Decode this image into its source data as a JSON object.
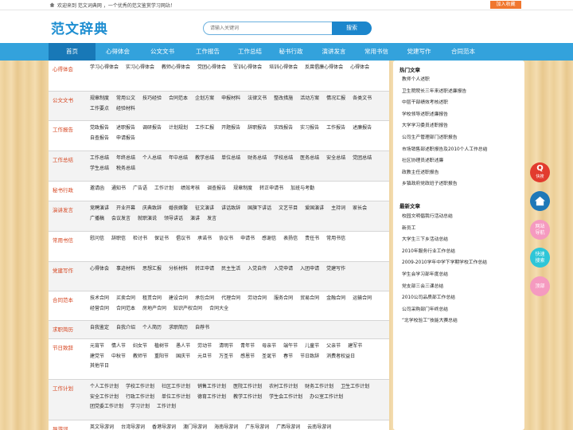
{
  "topbar": {
    "welcome": "欢迎来到 范文词典网 ，一个优秀的范文鉴赏学习网站！",
    "favorite_label": "加入收藏"
  },
  "header": {
    "logo": "范文辞典",
    "search_placeholder": "请输入关键词",
    "search_button": "搜索"
  },
  "nav": [
    "首页",
    "心得体会",
    "公文文书",
    "工作报告",
    "工作总结",
    "秘书行政",
    "演讲发言",
    "常用书信",
    "党建写作",
    "合同范本"
  ],
  "categories": [
    {
      "title": "心得体会",
      "links": [
        "学习心得体会",
        "实习心得体会",
        "教师心得体会",
        "党团心得体会",
        "军训心得体会",
        "培训心得体会",
        "反腐倡廉心得体会",
        "心得体会"
      ]
    },
    {
      "title": "公文文书",
      "links": [
        "规章制度",
        "常用公文",
        "技巧经验",
        "合同范本",
        "企划方案",
        "申报材料",
        "法律文书",
        "整改措施",
        "活动方案",
        "情况汇报",
        "各类文书",
        "工作要点",
        "经验材料"
      ]
    },
    {
      "title": "工作报告",
      "links": [
        "党政报告",
        "述职报告",
        "调研报告",
        "计划规划",
        "工作汇报",
        "开题报告",
        "辞职报告",
        "实践报告",
        "实习报告",
        "工作报告",
        "述廉报告",
        "自查报告",
        "申请报告"
      ]
    },
    {
      "title": "工作总结",
      "links": [
        "工作总结",
        "年终总结",
        "个人总结",
        "年中总结",
        "教学总结",
        "单位总结",
        "财务总结",
        "学校总结",
        "医务总结",
        "安全总结",
        "党团总结",
        "学生总结",
        "税务总结"
      ]
    },
    {
      "title": "秘书行政",
      "links": [
        "邀请函",
        "通知书",
        "广告语",
        "工作计划",
        "绩效考核",
        "调查报告",
        "规章制度",
        "转正申请书",
        "加班与考勤"
      ]
    },
    {
      "title": "演讲发言",
      "links": [
        "竞聘演讲",
        "开业开幕",
        "庆典致辞",
        "婚丧嫁娶",
        "征文演讲",
        "讲话致辞",
        "国旗下讲话",
        "文艺节目",
        "爱国演讲",
        "主持词",
        "家长会",
        "广播稿",
        "会议发言",
        "就职演说",
        "领导讲话",
        "演讲",
        "发言"
      ]
    },
    {
      "title": "常用书信",
      "links": [
        "慰问信",
        "辞职信",
        "检讨书",
        "保证书",
        "倡议书",
        "承诺书",
        "协议书",
        "申请书",
        "感谢信",
        "表扬信",
        "责任书",
        "常用书信"
      ]
    },
    {
      "title": "党建写作",
      "links": [
        "心得体会",
        "事迹材料",
        "思想汇报",
        "分析材料",
        "转正申请",
        "民主生活",
        "入党自传",
        "入党申请",
        "入团申请",
        "党建写作"
      ]
    },
    {
      "title": "合同范本",
      "links": [
        "技术合同",
        "买卖合同",
        "租赁合同",
        "建设合同",
        "承包合同",
        "代理合同",
        "劳动合同",
        "服务合同",
        "贸易合同",
        "金融合同",
        "运输合同",
        "经营合同",
        "合同范本",
        "房地产合同",
        "知识产权合同",
        "合同大全"
      ]
    },
    {
      "title": "求职简历",
      "links": [
        "自我鉴定",
        "自我介绍",
        "个人简历",
        "求职简历",
        "自荐书"
      ]
    },
    {
      "title": "节日致辞",
      "links": [
        "元宵节",
        "情人节",
        "妇女节",
        "植树节",
        "愚人节",
        "劳动节",
        "清明节",
        "青年节",
        "母亲节",
        "端午节",
        "儿童节",
        "父亲节",
        "建军节",
        "建党节",
        "中秋节",
        "教师节",
        "重阳节",
        "国庆节",
        "元旦节",
        "万圣节",
        "感恩节",
        "圣诞节",
        "春节",
        "节日致辞",
        "消费者权益日",
        "其他节日"
      ]
    },
    {
      "title": "工作计划",
      "links": [
        "个人工作计划",
        "学校工作计划",
        "社区工作计划",
        "销售工作计划",
        "医院工作计划",
        "农村工作计划",
        "财务工作计划",
        "卫生工作计划",
        "安全工作计划",
        "行政工作计划",
        "单位工作计划",
        "德育工作计划",
        "教学工作计划",
        "学生会工作计划",
        "办公室工作计划",
        "团党委工作计划",
        "学习计划",
        "工作计划"
      ]
    },
    {
      "title": "导游词",
      "links": [
        "英文导游词",
        "台湾导游词",
        "香港导游词",
        "澳门导游词",
        "海南导游词",
        "广东导游词",
        "广西导游词",
        "云南导游词"
      ]
    }
  ],
  "sidebar": {
    "hot_title": "热门文章",
    "hot": [
      "教师个人述职",
      "卫生院院长三年来述职述廉报告",
      "中层干部绩效考核述职",
      "学校领导述职述廉报告",
      "大学学习委员述职报告",
      "公司生产管理部门述职报告",
      "市场销售部述职报告及2010个人工作总结",
      "社区协理员述职述廉",
      "政教主任述职报告",
      "乡镇政府党政班子述职报告"
    ],
    "new_title": "最新文章",
    "new": [
      "校园文明倡我行活动总结",
      "新员工",
      "大学生三下乡活动总结",
      "2010年服务行业工作总结",
      "2009-2010学年中学下学期学校工作总结",
      "学生会学习部年度总结",
      "党支部三会三课总结",
      "2010公司品质部工作总结",
      "公司采购部门年终总结",
      "“北学校验工”技能大赛总结"
    ]
  },
  "float": {
    "q_label": "快搜",
    "nav_label": "网站\n导航",
    "search_label": "快速\n搜索",
    "top_label": "顶部"
  }
}
